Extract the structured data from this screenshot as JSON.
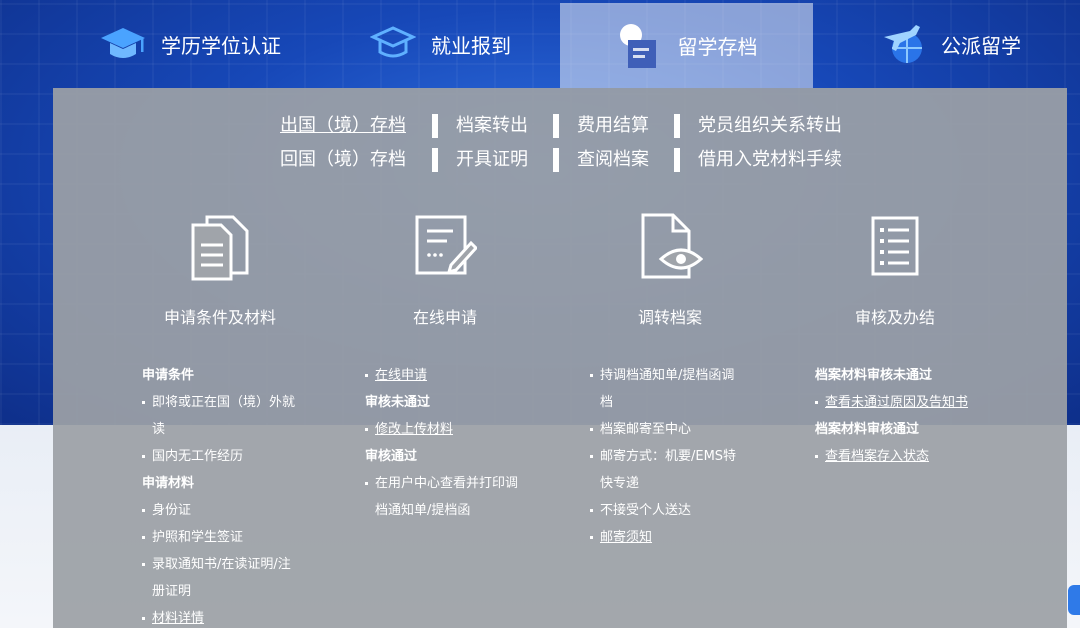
{
  "nav": {
    "tabs": [
      {
        "label": "学历学位认证",
        "icon": "graduation-cap-icon"
      },
      {
        "label": "就业报到",
        "icon": "mortarboard-outline-icon"
      },
      {
        "label": "留学存档",
        "icon": "archive-folder-icon"
      },
      {
        "label": "公派留学",
        "icon": "airplane-globe-icon"
      }
    ],
    "active_index": 2
  },
  "submenu": {
    "row1": [
      "出国（境）存档",
      "档案转出",
      "费用结算",
      "党员组织关系转出"
    ],
    "row2": [
      "回国（境）存档",
      "开具证明",
      "查阅档案",
      "借用入党材料手续"
    ],
    "active": "出国（境）存档"
  },
  "steps": [
    {
      "label": "申请条件及材料",
      "icon": "documents-icon"
    },
    {
      "label": "在线申请",
      "icon": "edit-form-icon"
    },
    {
      "label": "调转档案",
      "icon": "file-view-icon"
    },
    {
      "label": "审核及办结",
      "icon": "checklist-icon"
    }
  ],
  "col1": {
    "h1": "申请条件",
    "c1": "即将或正在国（境）外就",
    "c1b": "读",
    "c2": "国内无工作经历",
    "h2": "申请材料",
    "m1": "身份证",
    "m2": "护照和学生签证",
    "m3": "录取通知书/在读证明/注",
    "m3b": "册证明",
    "m4": "材料详情"
  },
  "col2": {
    "l1": "在线申请",
    "h1": "审核未通过",
    "l2": "修改上传材料",
    "h2": "审核通过",
    "t1": "在用户中心查看并打印调",
    "t1b": "档通知单/提档函"
  },
  "col3": {
    "t1": "持调档通知单/提档函调",
    "t1b": "档",
    "t2": "档案邮寄至中心",
    "t3": "邮寄方式：机要/EMS特",
    "t3b": "快专递",
    "t4": "不接受个人送达",
    "l1": "邮寄须知"
  },
  "col4": {
    "h1": "档案材料审核未通过",
    "l1": "查看未通过原因及告知书",
    "h2": "档案材料审核通过",
    "l2": "查看档案存入状态"
  }
}
